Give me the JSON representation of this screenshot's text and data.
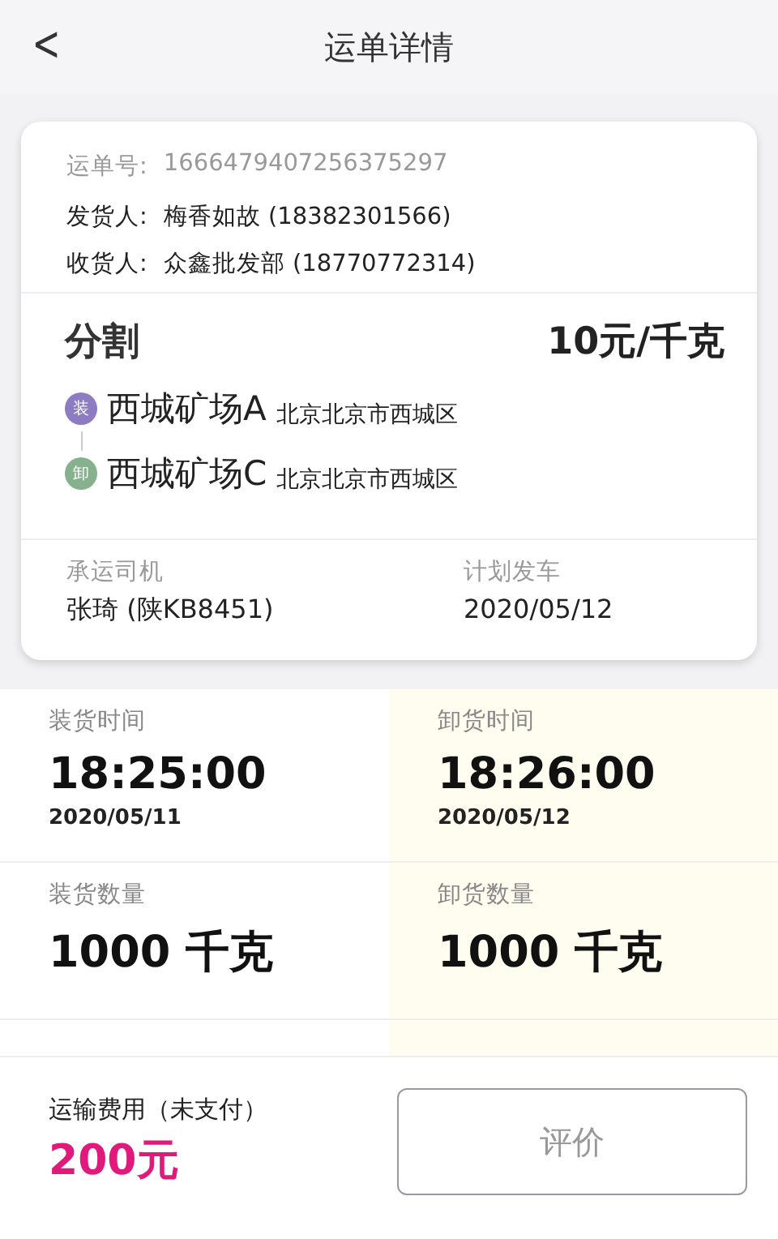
{
  "header": {
    "back": "<",
    "title": "运单详情"
  },
  "waybill": {
    "number_label": "运单号:",
    "number": "1666479407256375297",
    "shipper_label": "发货人:",
    "shipper": "梅香如故 (18382301566)",
    "receiver_label": "收货人:",
    "receiver": "众鑫批发部 (18770772314)"
  },
  "cargo": {
    "name": "分割",
    "price": "10元/千克"
  },
  "stops": [
    {
      "badge": "装",
      "color": "#8e7cc3",
      "name": "西城矿场A",
      "address": "北京北京市西城区"
    },
    {
      "badge": "卸",
      "color": "#86b08e",
      "name": "西城矿场C",
      "address": "北京北京市西城区"
    }
  ],
  "driver": {
    "label": "承运司机",
    "value": "张琦 (陕KB8451)"
  },
  "departure": {
    "label": "计划发车",
    "value": "2020/05/12"
  },
  "details": [
    {
      "label": "装货时间",
      "value": "18:25:00",
      "sub": "2020/05/11"
    },
    {
      "label": "卸货时间",
      "value": "18:26:00",
      "sub": "2020/05/12"
    },
    {
      "label": "装货数量",
      "value": "1000 千克"
    },
    {
      "label": "卸货数量",
      "value": "1000 千克"
    }
  ],
  "footer": {
    "fee_label": "运输费用（未支付）",
    "fee": "200元",
    "button": "评价"
  }
}
